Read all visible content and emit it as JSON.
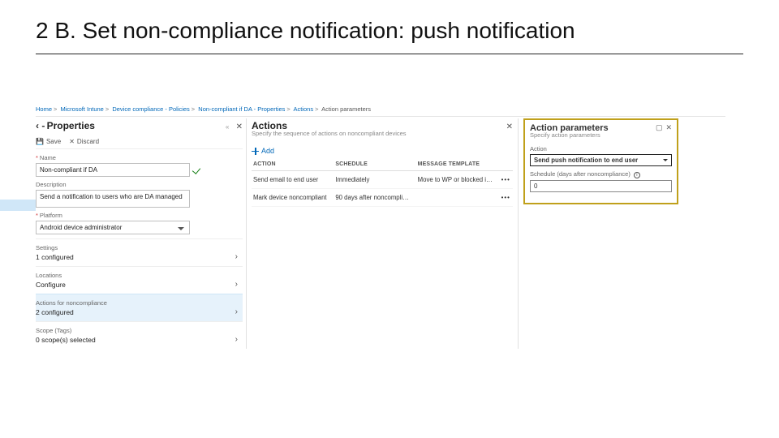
{
  "slide_title": "2 B. Set non-compliance notification: push notification",
  "breadcrumbs": [
    "Home",
    "Microsoft Intune",
    "Device compliance - Policies",
    "Non-compliant if DA - Properties",
    "Actions",
    "Action parameters"
  ],
  "props": {
    "prefix": "‹ -",
    "title": "Properties",
    "save": "Save",
    "discard": "Discard",
    "name_label": "Name",
    "name_value": "Non-compliant if DA",
    "desc_label": "Description",
    "desc_value": "Send a notification to users who are DA managed",
    "platform_label": "Platform",
    "platform_value": "Android device administrator",
    "rows": {
      "settings": {
        "label": "Settings",
        "value": "1 configured"
      },
      "locations": {
        "label": "Locations",
        "value": "Configure"
      },
      "actions": {
        "label": "Actions for noncompliance",
        "value": "2 configured"
      },
      "scope": {
        "label": "Scope (Tags)",
        "value": "0 scope(s) selected"
      }
    }
  },
  "actions": {
    "title": "Actions",
    "subtitle": "Specify the sequence of actions on noncompliant devices",
    "add": "Add",
    "headers": {
      "action": "ACTION",
      "schedule": "SCHEDULE",
      "template": "MESSAGE TEMPLATE"
    },
    "rows": [
      {
        "action": "Send email to end user",
        "schedule": "Immediately",
        "template": "Move to WP or blocked i…"
      },
      {
        "action": "Mark device noncompliant",
        "schedule": "90 days after noncompli…",
        "template": ""
      }
    ]
  },
  "params": {
    "title": "Action parameters",
    "subtitle": "Specify action parameters",
    "action_label": "Action",
    "action_value": "Send push notification to end user",
    "schedule_label": "Schedule (days after noncompliance)",
    "schedule_value": "0"
  }
}
